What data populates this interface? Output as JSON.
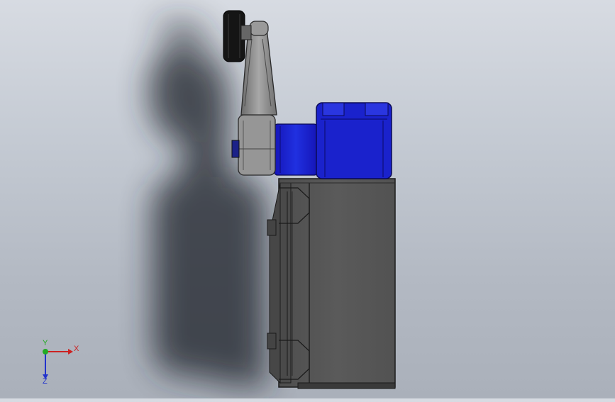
{
  "viewport": {
    "colors": {
      "background_top": "#d7dbe2",
      "background_bottom": "#aab0ba",
      "shadow": "#2a2d33",
      "housing": "#575757",
      "housing_edge": "#1f1f1f",
      "actuator_head": "#1c24c8",
      "actuator_collar": "#1a22d6",
      "lever_arm": "#8a8a8a",
      "roller": "#141414"
    },
    "model_parts": [
      "roller",
      "lever-arm",
      "lever-hub",
      "actuator-head",
      "switch-housing"
    ]
  },
  "triad": {
    "x_label": "X",
    "y_label": "Y",
    "z_label": "Z",
    "x_color": "#cc2222",
    "y_color": "#22aa22",
    "z_color": "#2233cc"
  }
}
